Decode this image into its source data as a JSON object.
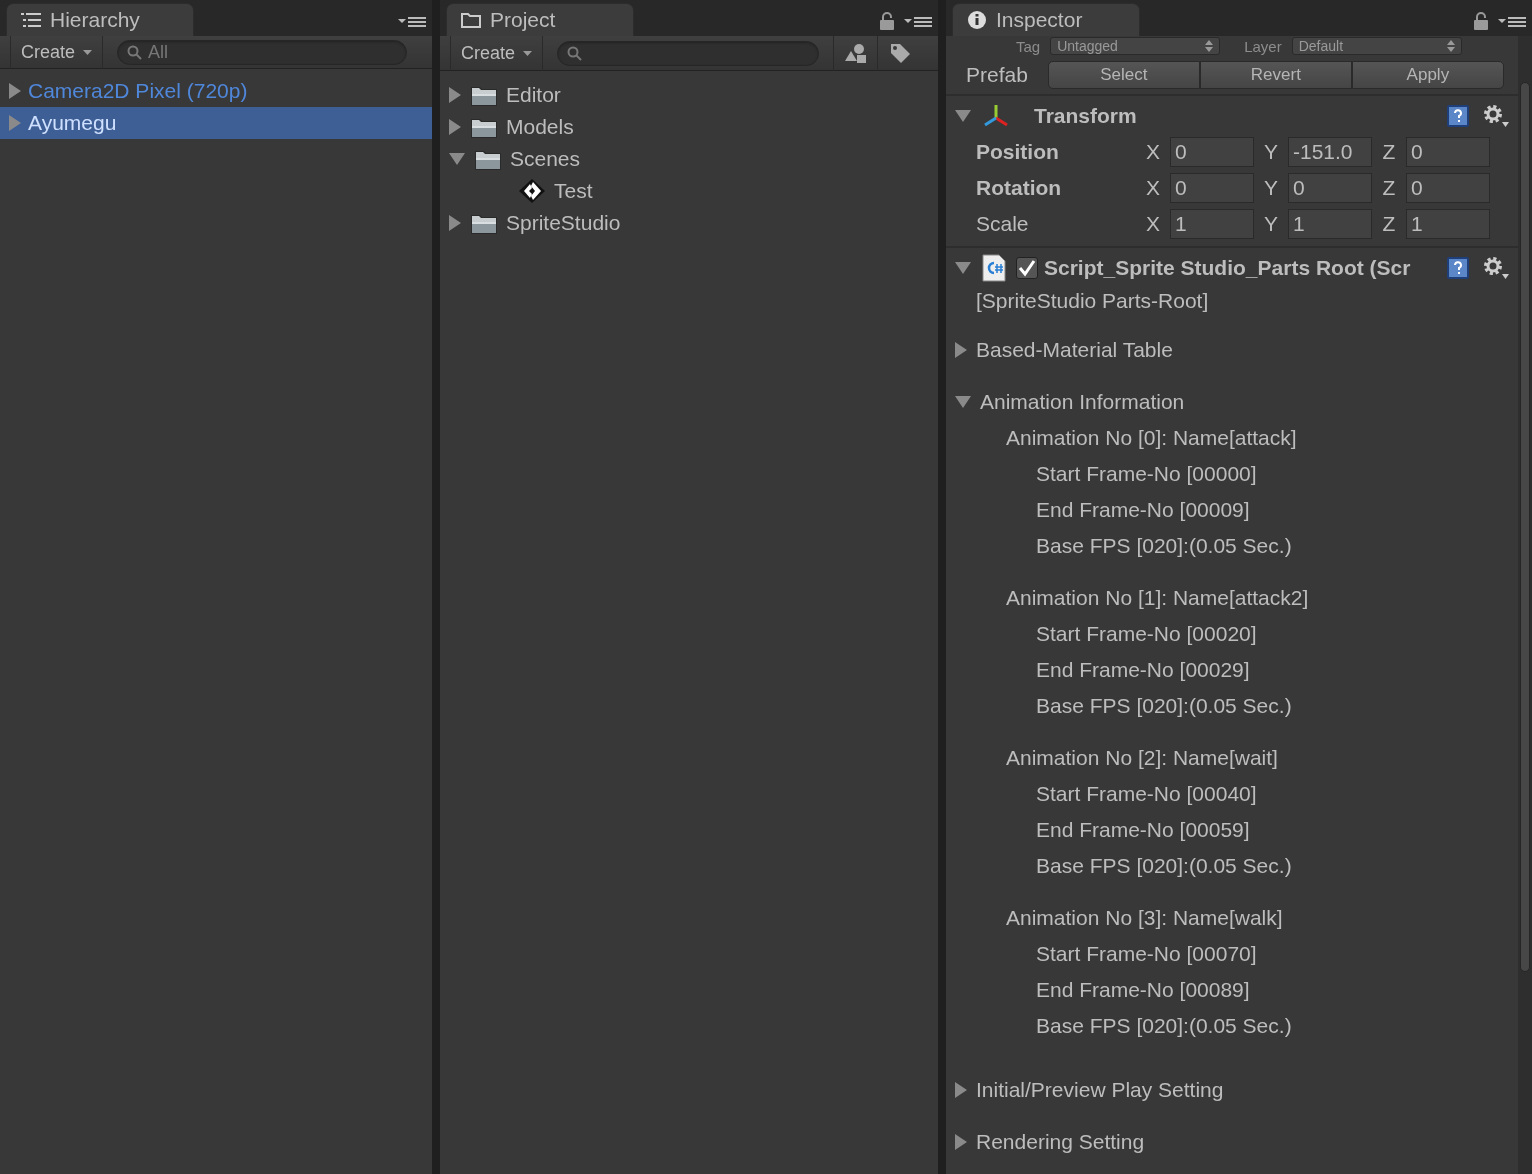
{
  "hierarchy": {
    "tab": "Hierarchy",
    "create_button": "Create",
    "search": {
      "placeholder": "All"
    },
    "items": [
      {
        "label": "Camera2D Pixel (720p)",
        "expanded": false,
        "selected": false
      },
      {
        "label": "Ayumegu",
        "expanded": false,
        "selected": true
      }
    ]
  },
  "project": {
    "tab": "Project",
    "create_button": "Create",
    "items": [
      {
        "kind": "folder",
        "label": "Editor",
        "expanded": false
      },
      {
        "kind": "folder",
        "label": "Models",
        "expanded": false
      },
      {
        "kind": "folder",
        "label": "Scenes",
        "expanded": true,
        "children": [
          {
            "kind": "scene",
            "label": "Test"
          }
        ]
      },
      {
        "kind": "folder",
        "label": "SpriteStudio",
        "expanded": false
      }
    ]
  },
  "inspector": {
    "tab": "Inspector",
    "tag_label": "Tag",
    "tag_value": "Untagged",
    "layer_label": "Layer",
    "layer_value": "Default",
    "prefab_label": "Prefab",
    "prefab_buttons": [
      "Select",
      "Revert",
      "Apply"
    ],
    "components": [
      {
        "kind": "transform",
        "title": "Transform",
        "expanded": true,
        "rows": [
          {
            "label": "Position",
            "overridden": true,
            "fields": [
              {
                "axis": "X",
                "value": "0"
              },
              {
                "axis": "Y",
                "value": "-151.0"
              },
              {
                "axis": "Z",
                "value": "0"
              }
            ]
          },
          {
            "label": "Rotation",
            "overridden": true,
            "fields": [
              {
                "axis": "X",
                "value": "0"
              },
              {
                "axis": "Y",
                "value": "0"
              },
              {
                "axis": "Z",
                "value": "0"
              }
            ]
          },
          {
            "label": "Scale",
            "overridden": false,
            "fields": [
              {
                "axis": "X",
                "value": "1"
              },
              {
                "axis": "Y",
                "value": "1"
              },
              {
                "axis": "Z",
                "value": "1"
              }
            ]
          }
        ]
      },
      {
        "kind": "script",
        "title": "Script_Sprite Studio_Parts Root (Scr",
        "expanded": true,
        "enabled": true,
        "subtitle": "[SpriteStudio Parts-Root]",
        "sections": [
          {
            "label": "Based-Material Table",
            "expanded": false
          },
          {
            "label": "Animation Information",
            "expanded": true,
            "animations": [
              {
                "title": "Animation No [0]: Name[attack]",
                "lines": [
                  "Start Frame-No [00000]",
                  "End Frame-No [00009]",
                  "Base FPS [020]:(0.05 Sec.)"
                ]
              },
              {
                "title": "Animation No [1]: Name[attack2]",
                "lines": [
                  "Start Frame-No [00020]",
                  "End Frame-No [00029]",
                  "Base FPS [020]:(0.05 Sec.)"
                ]
              },
              {
                "title": "Animation No [2]: Name[wait]",
                "lines": [
                  "Start Frame-No [00040]",
                  "End Frame-No [00059]",
                  "Base FPS [020]:(0.05 Sec.)"
                ]
              },
              {
                "title": "Animation No [3]: Name[walk]",
                "lines": [
                  "Start Frame-No [00070]",
                  "End Frame-No [00089]",
                  "Base FPS [020]:(0.05 Sec.)"
                ]
              }
            ]
          },
          {
            "label": "Initial/Preview Play Setting",
            "expanded": false
          },
          {
            "label": "Rendering Setting",
            "expanded": false
          }
        ]
      }
    ]
  }
}
